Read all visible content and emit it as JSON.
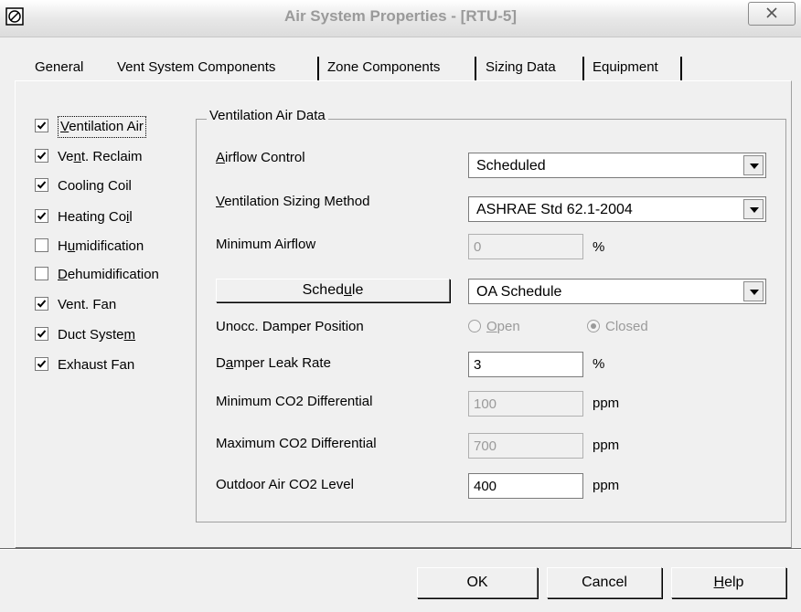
{
  "window": {
    "title": "Air System Properties - [RTU-5]",
    "close_label": "☒"
  },
  "tabs": [
    {
      "label": "General"
    },
    {
      "label": "Vent System Components"
    },
    {
      "label": "Zone Components"
    },
    {
      "label": "Sizing Data"
    },
    {
      "label": "Equipment"
    }
  ],
  "components": [
    {
      "label": "Ventilation Air",
      "checked": true
    },
    {
      "label": "Vent. Reclaim",
      "checked": true
    },
    {
      "label": "Cooling Coil",
      "checked": true
    },
    {
      "label": "Heating Coil",
      "checked": true
    },
    {
      "label": "Humidification",
      "checked": false
    },
    {
      "label": "Dehumidification",
      "checked": false
    },
    {
      "label": "Vent. Fan",
      "checked": true
    },
    {
      "label": "Duct System",
      "checked": true
    },
    {
      "label": "Exhaust Fan",
      "checked": true
    }
  ],
  "group": {
    "title": "Ventilation Air Data",
    "airflow_control": {
      "label": "Airflow Control",
      "value": "Scheduled"
    },
    "sizing_method": {
      "label": "Ventilation Sizing Method",
      "value": "ASHRAE Std 62.1-2004"
    },
    "min_airflow": {
      "label": "Minimum Airflow",
      "value": "0",
      "unit": "%"
    },
    "schedule": {
      "button_label": "Schedule",
      "value": "OA Schedule"
    },
    "damper_position": {
      "label": "Unocc. Damper Position",
      "open_label": "Open",
      "closed_label": "Closed",
      "selected": "Closed"
    },
    "leak_rate": {
      "label": "Damper Leak Rate",
      "value": "3",
      "unit": "%"
    },
    "min_co2": {
      "label": "Minimum CO2 Differential",
      "value": "100",
      "unit": "ppm"
    },
    "max_co2": {
      "label": "Maximum CO2 Differential",
      "value": "700",
      "unit": "ppm"
    },
    "outdoor_co2": {
      "label": "Outdoor Air CO2 Level",
      "value": "400",
      "unit": "ppm"
    }
  },
  "buttons": {
    "ok": "OK",
    "cancel": "Cancel",
    "help": "Help"
  }
}
